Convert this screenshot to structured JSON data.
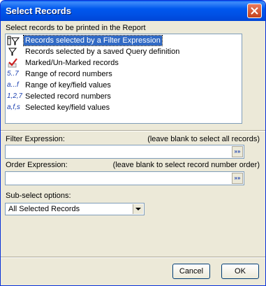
{
  "window": {
    "title": "Select Records",
    "close_icon": "close-icon"
  },
  "record_source": {
    "label": "Select records to be printed in the Report",
    "selected_index": 0,
    "items": [
      {
        "icon_text": "",
        "icon": "filter-expression-icon",
        "label": "Records selected by a Filter Expression"
      },
      {
        "icon_text": "",
        "icon": "saved-query-icon",
        "label": "Records selected by a saved Query definition"
      },
      {
        "icon_text": "",
        "icon": "checkmark-icon",
        "label": "Marked/Un-Marked records"
      },
      {
        "icon_text": "5..7",
        "icon": "record-range-icon",
        "label": "Range of record numbers"
      },
      {
        "icon_text": "a...f",
        "icon": "key-range-icon",
        "label": "Range of key/field values"
      },
      {
        "icon_text": "1,2,7",
        "icon": "record-numbers-icon",
        "label": "Selected record numbers"
      },
      {
        "icon_text": "a,f,s",
        "icon": "key-values-icon",
        "label": "Selected key/field values"
      }
    ]
  },
  "filter": {
    "label": "Filter Expression:",
    "hint": "(leave blank to select all records)",
    "value": "",
    "button_icon": "expand-icon",
    "button_text": "»»"
  },
  "order": {
    "label": "Order Expression:",
    "hint": "(leave blank to select record number order)",
    "value": "",
    "button_icon": "expand-icon",
    "button_text": "»»"
  },
  "subselect": {
    "label": "Sub-select options:",
    "value": "All Selected Records"
  },
  "buttons": {
    "cancel": "Cancel",
    "ok": "OK"
  },
  "colors": {
    "titlebar": "#0058ee",
    "selection": "#316ac5",
    "dialog_bg": "#ece9d8"
  }
}
